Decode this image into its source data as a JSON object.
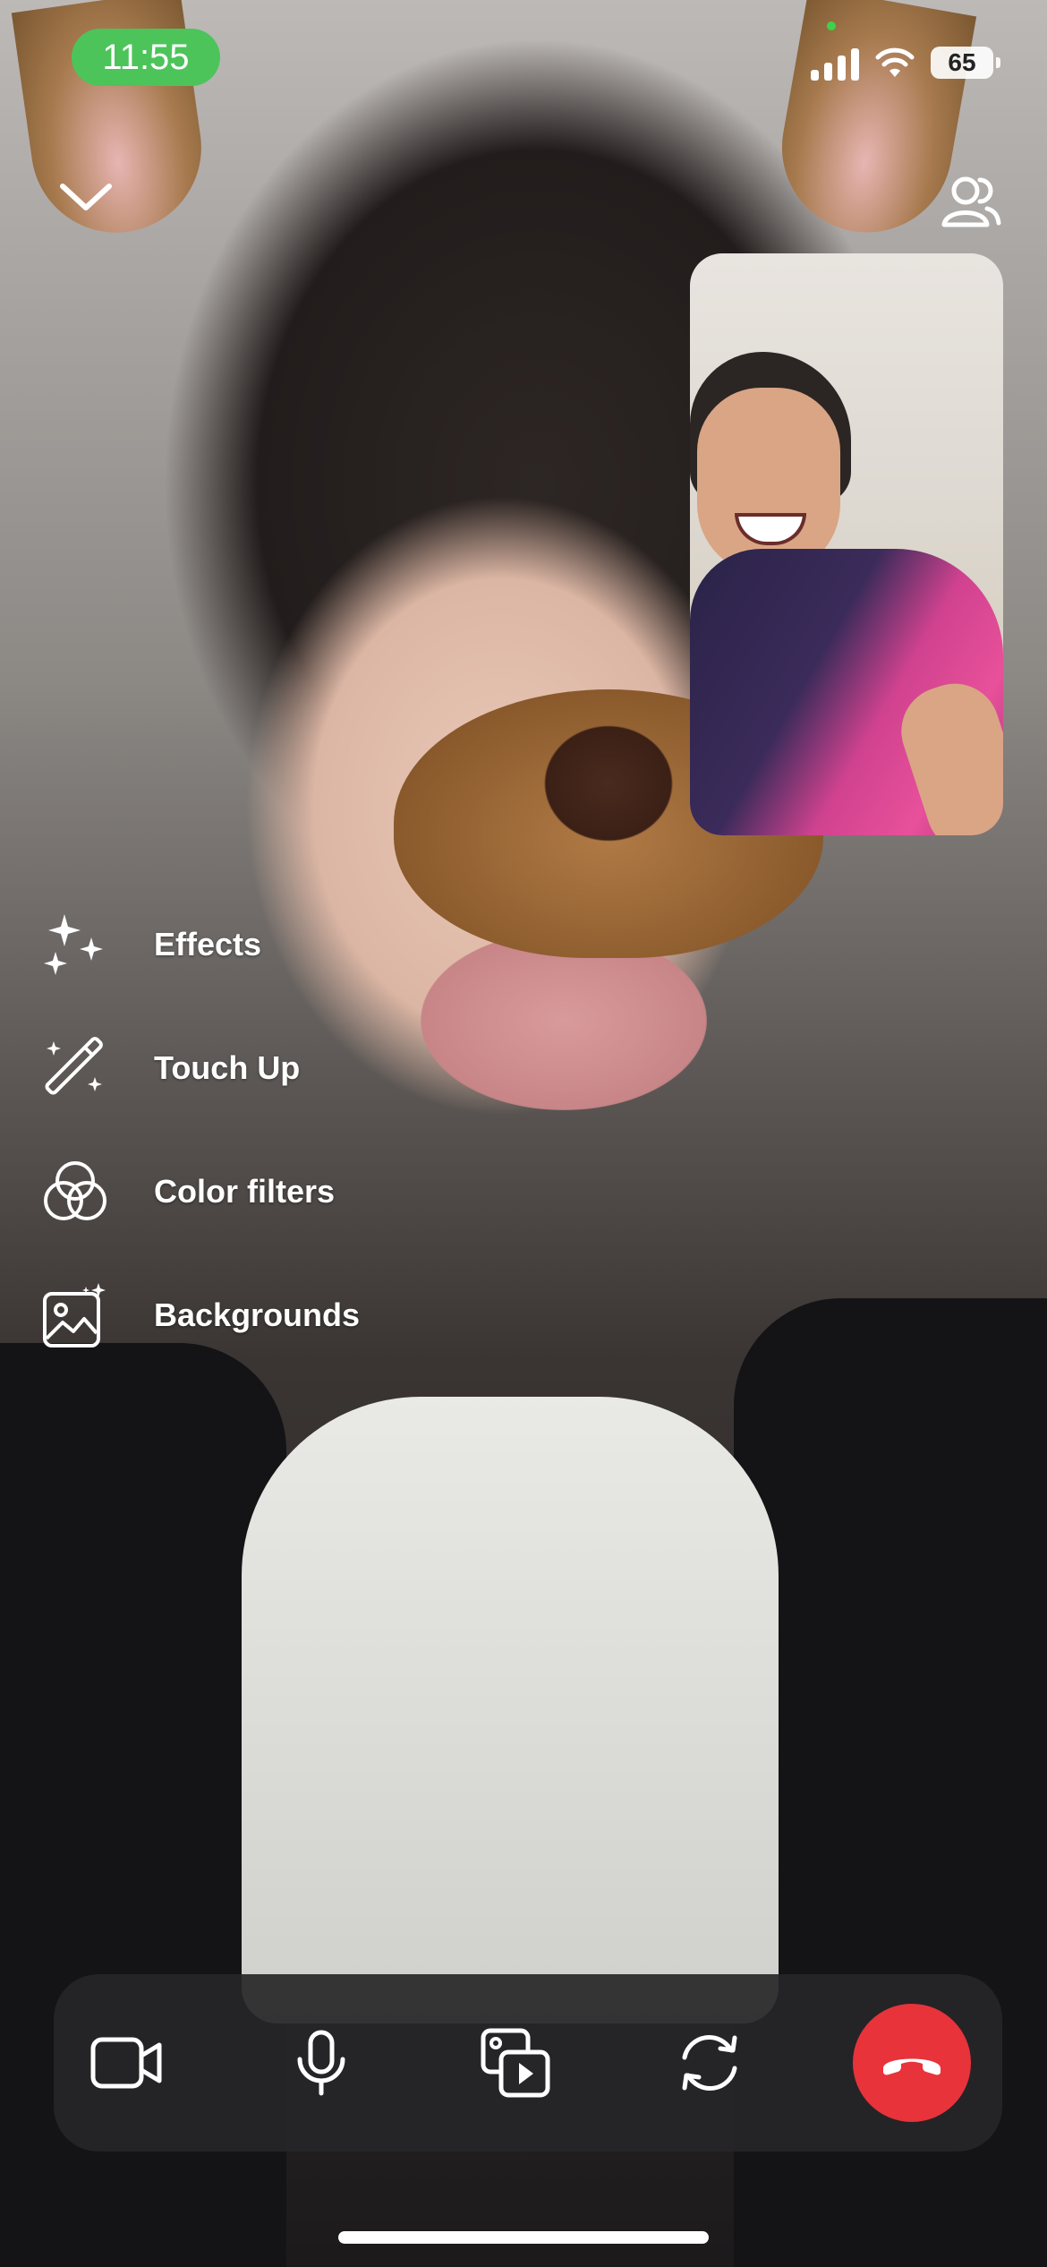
{
  "status_bar": {
    "time": "11:55",
    "battery": "65",
    "accent_color": "#4cc45a",
    "icons": [
      "cellular-signal-icon",
      "wifi-icon",
      "battery-icon"
    ]
  },
  "header": {
    "collapse_icon": "chevron-down-icon",
    "participants_icon": "people-icon"
  },
  "effects_menu": {
    "items": [
      {
        "label": "Effects",
        "icon": "sparkles-icon"
      },
      {
        "label": "Touch Up",
        "icon": "magic-wand-icon"
      },
      {
        "label": "Color filters",
        "icon": "color-filter-icon"
      },
      {
        "label": "Backgrounds",
        "icon": "background-image-icon"
      }
    ]
  },
  "controls": {
    "items": [
      {
        "name": "camera",
        "icon": "video-camera-icon"
      },
      {
        "name": "microphone",
        "icon": "microphone-icon"
      },
      {
        "name": "share",
        "icon": "media-share-icon"
      },
      {
        "name": "flip-camera",
        "icon": "flip-camera-icon"
      },
      {
        "name": "end-call",
        "icon": "end-call-icon"
      }
    ],
    "end_call_color": "#e8333b"
  }
}
